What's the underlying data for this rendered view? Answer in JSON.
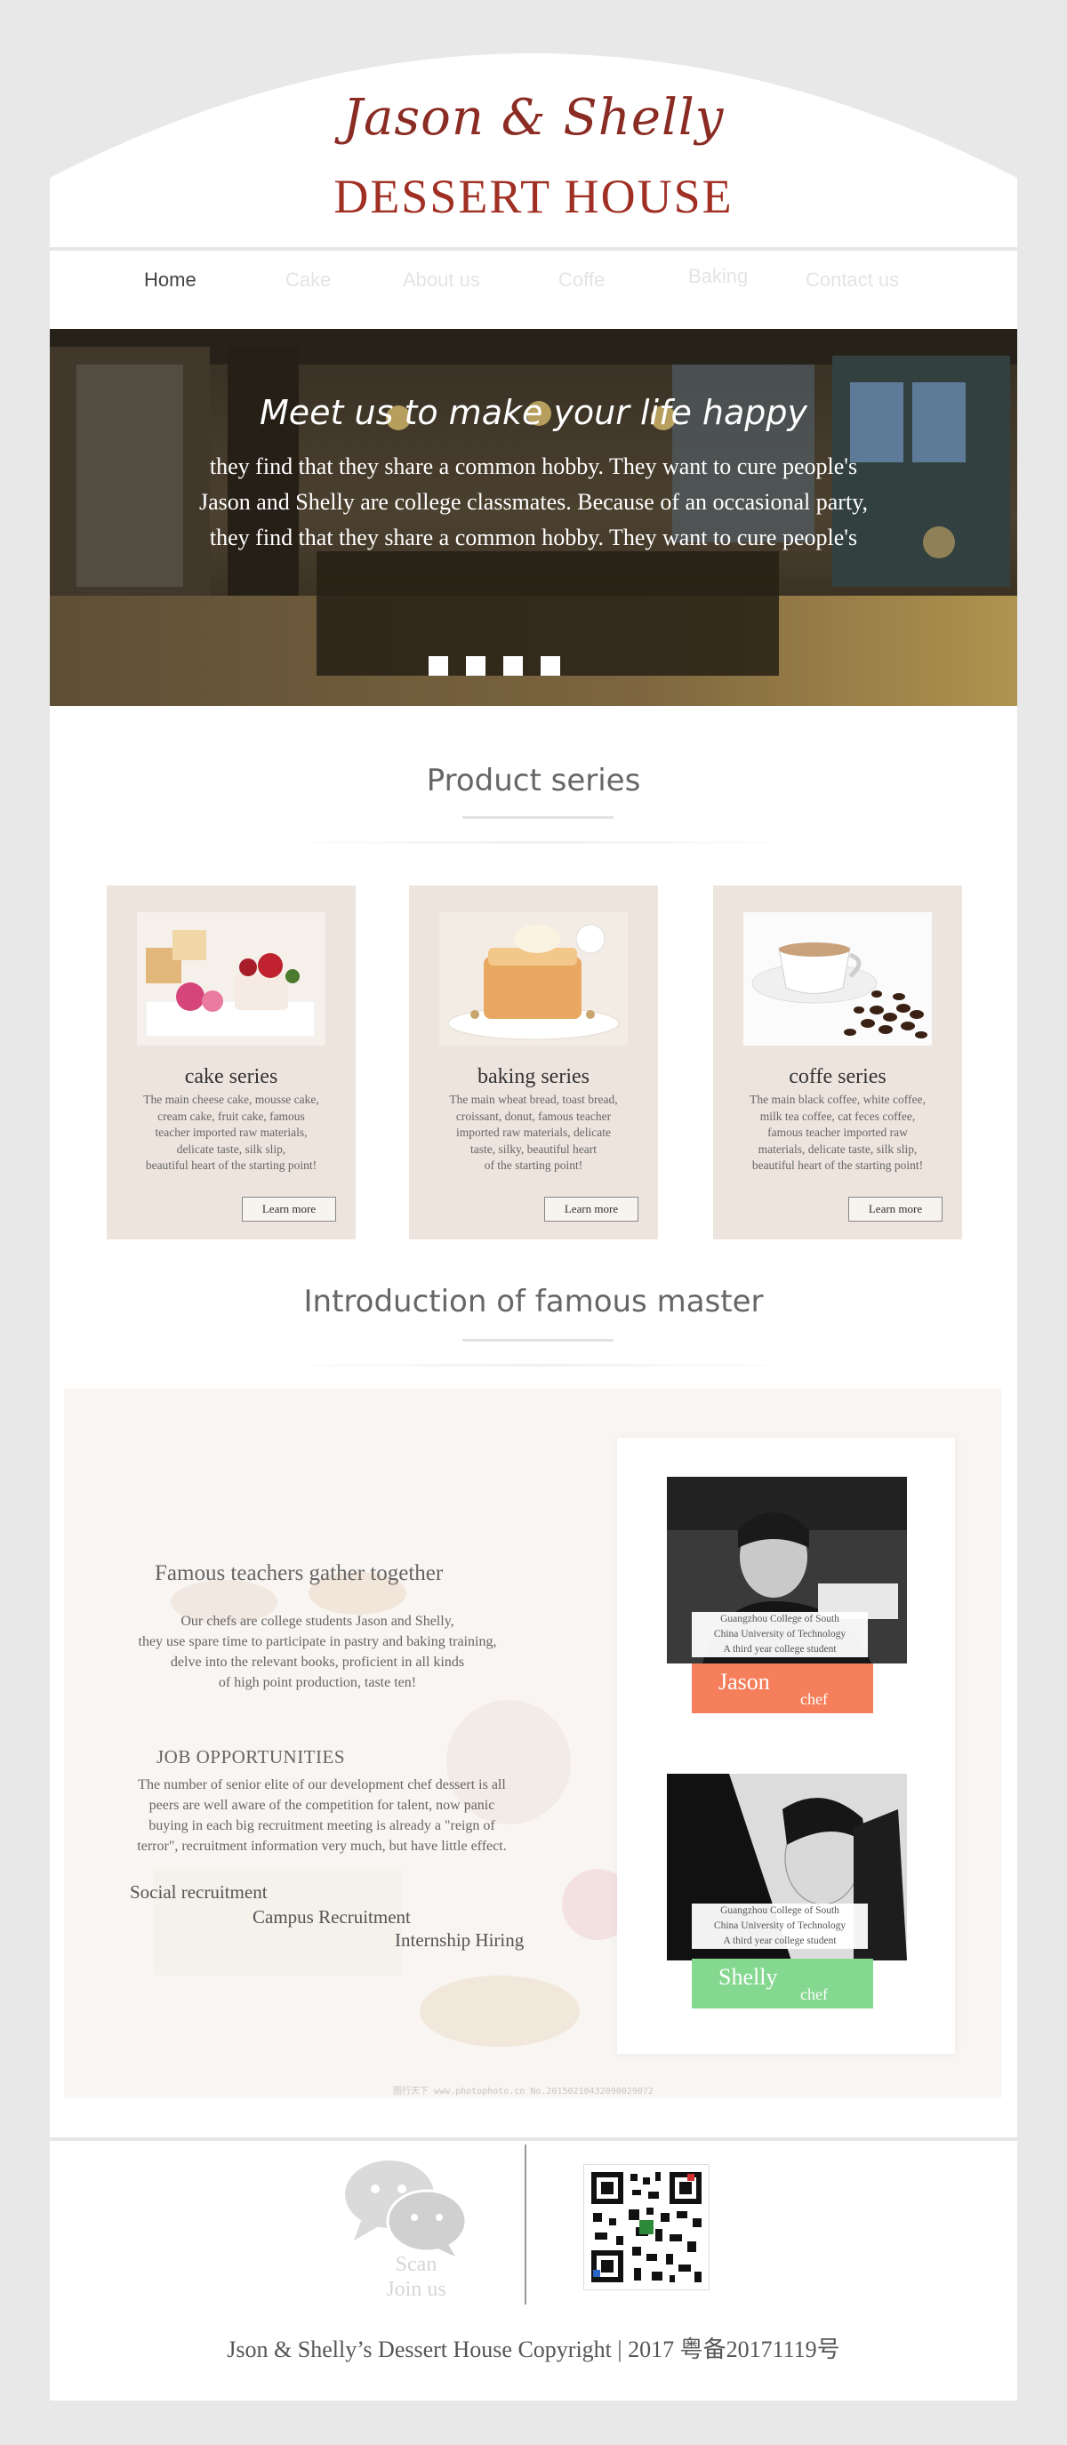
{
  "brand": {
    "script_title": "Jason & Shelly",
    "house_title": "DESSERT HOUSE",
    "title_color": "#a02f24"
  },
  "nav": {
    "items": [
      "Home",
      "Cake",
      "About us",
      "Coffe",
      "Baking",
      "Contact us"
    ],
    "active": "Home"
  },
  "banner": {
    "heading": "Meet us to make your life happy",
    "lines": [
      "they find that they share a common hobby. They want to cure people's",
      "Jason and Shelly are college classmates. Because of an occasional party,",
      "they find that they share a common hobby. They want to cure people's"
    ],
    "slides": 4
  },
  "products": {
    "title": "Product  series",
    "cards": [
      {
        "title": "cake series",
        "desc": [
          "The main cheese cake, mousse cake,",
          "cream cake, fruit cake, famous",
          "teacher imported raw materials,",
          "delicate taste, silk slip,",
          "beautiful heart of the starting point!"
        ],
        "button": "Learn more"
      },
      {
        "title": "baking series",
        "desc": [
          "The main wheat bread, toast bread,",
          "croissant, donut, famous teacher",
          "imported raw materials, delicate",
          "taste, silky, beautiful heart",
          "of the starting point!"
        ],
        "button": "Learn more"
      },
      {
        "title": "coffe series",
        "desc": [
          "The main black coffee, white coffee,",
          "milk tea coffee, cat feces coffee,",
          "famous teacher imported raw",
          "materials, delicate taste, silk slip,",
          "beautiful heart of the starting point!"
        ],
        "button": "Learn more"
      }
    ]
  },
  "masters": {
    "title": "Introduction of famous master",
    "heading": "Famous teachers gather together",
    "intro": [
      "Our chefs are college students Jason and Shelly,",
      "they use spare time to participate in pastry and baking training,",
      "delve into the relevant books, proficient in all kinds",
      "of high point production, taste ten!"
    ],
    "job_heading": "JOB OPPORTUNITIES",
    "job_text": [
      "The number of senior elite of our development chef dessert is all",
      "peers are well aware of the competition for talent, now panic",
      "buying in each big recruitment meeting is already a \"reign of",
      "terror\", recruitment information very much, but have little effect."
    ],
    "links": [
      "Social recruitment",
      "Campus Recruitment",
      "Internship Hiring"
    ],
    "chefs": [
      {
        "name": "Jason",
        "role": "chef",
        "caption": [
          "Guangzhou College of South",
          "China University of Technology",
          "A third year college student"
        ],
        "tag_color": "#f57f5b"
      },
      {
        "name": "Shelly",
        "role": "chef",
        "caption": [
          "Guangzhou College of South",
          "China University of Technology",
          "A third year college student"
        ],
        "tag_color": "#84d88f"
      }
    ],
    "watermark": "图行天下 www.photophoto.cn  No.20150210432090029072"
  },
  "footer": {
    "scan": "Scan",
    "join": "Join us",
    "copyright": "Json & Shelly’s Dessert House   Copyright   |   2017  粤备20171119号"
  }
}
